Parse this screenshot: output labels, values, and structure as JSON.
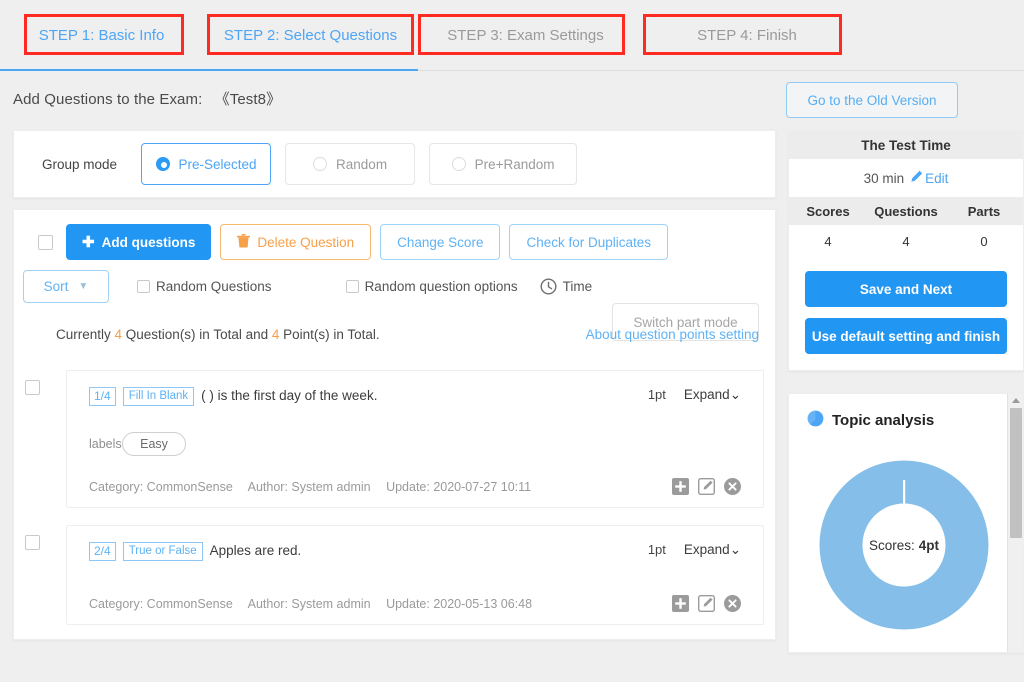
{
  "steps": [
    {
      "label": "STEP 1: Basic Info",
      "active": true
    },
    {
      "label": "STEP 2: Select Questions",
      "active": true
    },
    {
      "label": "STEP 3: Exam Settings",
      "active": false
    },
    {
      "label": "STEP 4: Finish",
      "active": false
    }
  ],
  "header": {
    "title": "Add Questions to the Exam:",
    "exam_name": "《Test8》",
    "old_version_button": "Go to the Old Version"
  },
  "group_mode": {
    "label": "Group mode",
    "options": [
      {
        "label": "Pre-Selected",
        "selected": true
      },
      {
        "label": "Random",
        "selected": false
      },
      {
        "label": "Pre+Random",
        "selected": false
      }
    ]
  },
  "toolbar": {
    "add_questions": "Add questions",
    "delete_question": "Delete Question",
    "change_score": "Change Score",
    "check_duplicates": "Check for Duplicates",
    "sort": "Sort",
    "random_questions": "Random Questions",
    "random_question_options": "Random question options",
    "time": "Time",
    "switch_part_mode": "Switch part mode"
  },
  "summary": {
    "prefix": "Currently ",
    "count": "4",
    "mid": " Question(s) in Total and ",
    "points": "4",
    "suffix": " Point(s) in Total.",
    "points_link": "About question points setting"
  },
  "questions": [
    {
      "index": "1/4",
      "type": "Fill In Blank",
      "text": "( ) is the first day of the week.",
      "points": "1pt",
      "expand": "Expand",
      "labels_prefix": "labels:",
      "label_pill": "Easy",
      "category": "Category: CommonSense",
      "author": "Author: System admin",
      "update": "Update: 2020-07-27 10:11"
    },
    {
      "index": "2/4",
      "type": "True or False",
      "text": "Apples are red.",
      "points": "1pt",
      "expand": "Expand",
      "labels_prefix": "",
      "label_pill": "",
      "category": "Category: CommonSense",
      "author": "Author: System admin",
      "update": "Update: 2020-05-13 06:48"
    }
  ],
  "sidebar": {
    "test_time_title": "The Test Time",
    "test_time_value": "30 min",
    "edit_label": "Edit",
    "stats_headers": [
      "Scores",
      "Questions",
      "Parts"
    ],
    "stats_values": [
      "4",
      "4",
      "0"
    ],
    "save_and_next": "Save and Next",
    "use_default": "Use default setting and finish",
    "topic_analysis_title": "Topic analysis"
  },
  "chart_data": {
    "type": "pie",
    "title": "Topic analysis",
    "center_label": "Scores:",
    "center_value": "4pt",
    "categories": [
      "CommonSense"
    ],
    "values": [
      4
    ],
    "total": 4,
    "colors": [
      "#85bfe9"
    ],
    "donut": true,
    "legend": "none"
  },
  "colors": {
    "accent": "#2196f3",
    "link": "#5eb2f5",
    "warn": "#f6a04b",
    "highlight_box": "#ff2a22",
    "chart": "#85bfe9"
  }
}
